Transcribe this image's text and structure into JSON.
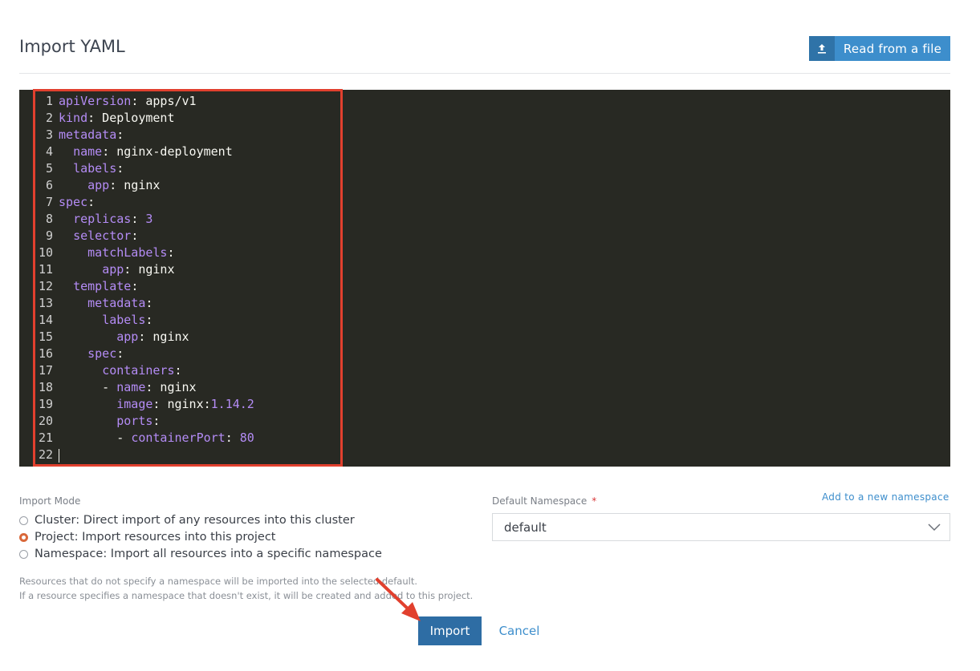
{
  "header": {
    "title": "Import YAML",
    "read_file_label": "Read from a file"
  },
  "editor": {
    "lines": [
      [
        {
          "t": "apiVersion",
          "c": "k"
        },
        {
          "t": ": apps/v1",
          "c": "v"
        }
      ],
      [
        {
          "t": "kind",
          "c": "k"
        },
        {
          "t": ": Deployment",
          "c": "v"
        }
      ],
      [
        {
          "t": "metadata",
          "c": "k"
        },
        {
          "t": ":",
          "c": "v"
        }
      ],
      [
        {
          "t": "  ",
          "c": "v"
        },
        {
          "t": "name",
          "c": "k"
        },
        {
          "t": ": nginx-deployment",
          "c": "v"
        }
      ],
      [
        {
          "t": "  ",
          "c": "v"
        },
        {
          "t": "labels",
          "c": "k"
        },
        {
          "t": ":",
          "c": "v"
        }
      ],
      [
        {
          "t": "    ",
          "c": "v"
        },
        {
          "t": "app",
          "c": "k"
        },
        {
          "t": ": nginx",
          "c": "v"
        }
      ],
      [
        {
          "t": "spec",
          "c": "k"
        },
        {
          "t": ":",
          "c": "v"
        }
      ],
      [
        {
          "t": "  ",
          "c": "v"
        },
        {
          "t": "replicas",
          "c": "k"
        },
        {
          "t": ": ",
          "c": "v"
        },
        {
          "t": "3",
          "c": "n"
        }
      ],
      [
        {
          "t": "  ",
          "c": "v"
        },
        {
          "t": "selector",
          "c": "k"
        },
        {
          "t": ":",
          "c": "v"
        }
      ],
      [
        {
          "t": "    ",
          "c": "v"
        },
        {
          "t": "matchLabels",
          "c": "k"
        },
        {
          "t": ":",
          "c": "v"
        }
      ],
      [
        {
          "t": "      ",
          "c": "v"
        },
        {
          "t": "app",
          "c": "k"
        },
        {
          "t": ": nginx",
          "c": "v"
        }
      ],
      [
        {
          "t": "  ",
          "c": "v"
        },
        {
          "t": "template",
          "c": "k"
        },
        {
          "t": ":",
          "c": "v"
        }
      ],
      [
        {
          "t": "    ",
          "c": "v"
        },
        {
          "t": "metadata",
          "c": "k"
        },
        {
          "t": ":",
          "c": "v"
        }
      ],
      [
        {
          "t": "      ",
          "c": "v"
        },
        {
          "t": "labels",
          "c": "k"
        },
        {
          "t": ":",
          "c": "v"
        }
      ],
      [
        {
          "t": "        ",
          "c": "v"
        },
        {
          "t": "app",
          "c": "k"
        },
        {
          "t": ": nginx",
          "c": "v"
        }
      ],
      [
        {
          "t": "    ",
          "c": "v"
        },
        {
          "t": "spec",
          "c": "k"
        },
        {
          "t": ":",
          "c": "v"
        }
      ],
      [
        {
          "t": "      ",
          "c": "v"
        },
        {
          "t": "containers",
          "c": "k"
        },
        {
          "t": ":",
          "c": "v"
        }
      ],
      [
        {
          "t": "      - ",
          "c": "v"
        },
        {
          "t": "name",
          "c": "k"
        },
        {
          "t": ": nginx",
          "c": "v"
        }
      ],
      [
        {
          "t": "        ",
          "c": "v"
        },
        {
          "t": "image",
          "c": "k"
        },
        {
          "t": ": nginx:",
          "c": "v"
        },
        {
          "t": "1.14.2",
          "c": "n"
        }
      ],
      [
        {
          "t": "        ",
          "c": "v"
        },
        {
          "t": "ports",
          "c": "k"
        },
        {
          "t": ":",
          "c": "v"
        }
      ],
      [
        {
          "t": "        - ",
          "c": "v"
        },
        {
          "t": "containerPort",
          "c": "k"
        },
        {
          "t": ": ",
          "c": "v"
        },
        {
          "t": "80",
          "c": "n"
        }
      ],
      []
    ]
  },
  "import_mode": {
    "label": "Import Mode",
    "options": [
      {
        "label": "Cluster: Direct import of any resources into this cluster",
        "checked": false
      },
      {
        "label": "Project: Import resources into this project",
        "checked": true
      },
      {
        "label": "Namespace: Import all resources into a specific namespace",
        "checked": false
      }
    ],
    "hint_1": "Resources that do not specify a namespace will be imported into the selected default.",
    "hint_2": "If a resource specifies a namespace that doesn't exist, it will be created and added to this project."
  },
  "namespace": {
    "label": "Default Namespace",
    "required_mark": "*",
    "add_link": "Add to a new namespace",
    "selected": "default"
  },
  "actions": {
    "import_label": "Import",
    "cancel_label": "Cancel"
  },
  "colors": {
    "accent": "#3d8ecc",
    "primary": "#2e6da4",
    "annotation": "#e1402e",
    "radio_checked": "#d9683a"
  }
}
